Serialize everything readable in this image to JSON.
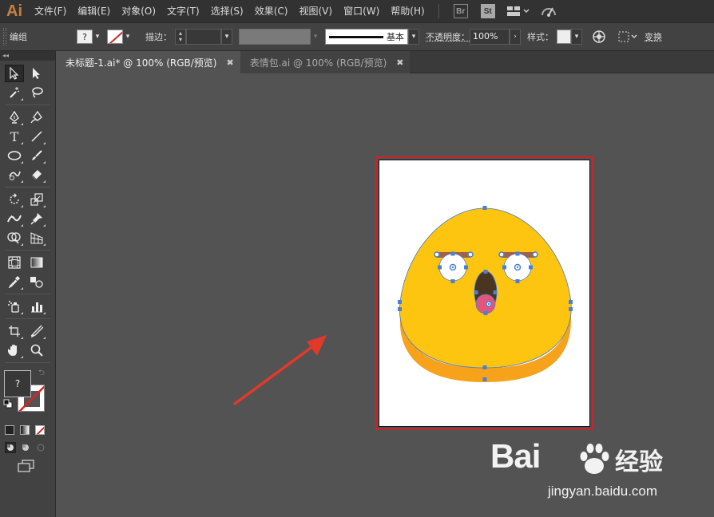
{
  "app": {
    "logo": "Ai"
  },
  "menu": {
    "items": [
      "文件(F)",
      "编辑(E)",
      "对象(O)",
      "文字(T)",
      "选择(S)",
      "效果(C)",
      "视图(V)",
      "窗口(W)",
      "帮助(H)"
    ],
    "bridge_label": "Br",
    "stock_label": "St"
  },
  "control_bar": {
    "selection_label": "编组",
    "fill_swatch_text": "?",
    "stroke_label": "描边：",
    "stroke_style_label": "基本",
    "opacity_label": "不透明度：",
    "opacity_value": "100%",
    "style_label": "样式：",
    "transform_label": "变换"
  },
  "tabs": [
    {
      "label": "未标题-1.ai* @ 100% (RGB/预览)",
      "active": true
    },
    {
      "label": "表情包.ai @ 100% (RGB/预览)",
      "active": false
    }
  ],
  "toolbox": {
    "collapse_glyph": "◂◂",
    "fill_swatch_text": "?"
  },
  "colors": {
    "face_yellow": "#fec510",
    "face_side_orange": "#f6a21a",
    "eyebrow_brown": "#a0614a",
    "mouth_dark": "#4a3620",
    "tongue_pink": "#e3567b",
    "selection_blue": "#4a7fd4",
    "artboard_outline": "#c8242e",
    "arrow_red": "#e23a2a"
  },
  "watermark": {
    "brand_left": "Bai",
    "brand_right": "经验",
    "url": "jingyan.baidu.com"
  }
}
